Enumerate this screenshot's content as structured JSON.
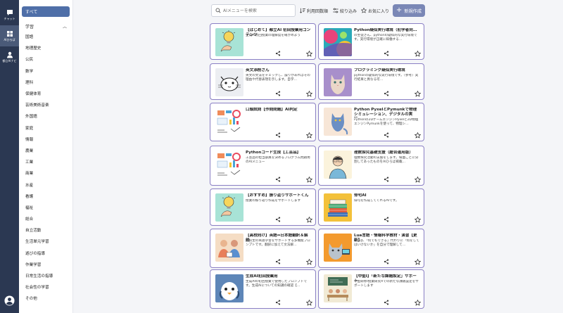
{
  "rail": {
    "items": [
      {
        "label": "チャット",
        "icon": "chat-icon"
      },
      {
        "label": "AIひろば",
        "icon": "grid-icon"
      },
      {
        "label": "都立AIナビ",
        "icon": "person-icon"
      }
    ]
  },
  "sidebar": {
    "all_label": "すべて",
    "section_label": "学習",
    "categories": [
      "国語",
      "地理歴史",
      "公民",
      "数学",
      "理科",
      "保健体育",
      "芸術美術音楽",
      "外国語",
      "家庭",
      "情報",
      "農業",
      "工業",
      "商業",
      "水産",
      "看護",
      "福祉",
      "総合",
      "自立活動",
      "生活単元学習",
      "遊びの指導",
      "作業学習",
      "日常生活の指導",
      "社会性の学習",
      "その他"
    ]
  },
  "toolbar": {
    "search_placeholder": "AIメニューを検索",
    "sort_label": "利用回数順",
    "filter_label": "絞り込み",
    "favorites_label": "お気に入り",
    "new_label": "新規作成"
  },
  "colors": {
    "rail": "#2b3852",
    "accent": "#4f6fa8",
    "card_border": "#8a7fc4",
    "new_button": "#7a87b6"
  },
  "cards": [
    {
      "title": "【はじめて】都立AI 初回授業用コンテンツ",
      "desc": "生成AI初回授業の理解度を確かめよう",
      "thumb": "lightbulb"
    },
    {
      "title": "Python疑似実行環境（初学者向…",
      "desc": "の生徒さん、pythonの疑似的な実行環境です。実行環境が正確に稼働する…",
      "thumb": "abstract"
    },
    {
      "title": "英文添削さん",
      "desc": "英文の文法をチェックし、誤りがあればその理由や代替表現を示します。自学…",
      "thumb": "cat"
    },
    {
      "title": "プログラミング疑似実行環境",
      "desc": "pythonの疑似的な実行環境です。（参考）実行結果と異なる可…",
      "thumb": "purplecat"
    },
    {
      "title": "口頭試問【作問問題】AI判定",
      "desc": "",
      "thumb": "infographic"
    },
    {
      "title": "Python PyxelとPymunkで物理シミュレーション、デジタルの実験…",
      "desc": "Pythonの2DゲームエンジンPyxelと2D物理エンジンPymunkを使って、物理シ…",
      "thumb": "bluecat"
    },
    {
      "title": "Pythonコード生成【工芸品】",
      "desc": "工芸品の担当部員を決めるプログラム問題用のAIメニュー",
      "thumb": "infographic"
    },
    {
      "title": "理数探究基礎支援（総合運用版）",
      "desc": "理数探究活動の支援をします。場面ごとに分割してあったものをAIひろば掲載…",
      "thumb": "student"
    },
    {
      "title": "【おすすめ】振り返りサポートくん",
      "desc": "授業の振り返り作成をサポートします",
      "thumb": "lightbulb"
    },
    {
      "title": "俳句AI",
      "desc": "俳句を作成してくれるAIです。",
      "thumb": "books"
    },
    {
      "title": "【高校向け】英語⇔日本語翻訳＆解説",
      "desc": "高校生の英語学習をサポートする多機能プロンプトです。翻訳に加えて文法解…",
      "thumb": "people"
    },
    {
      "title": "Lua言語・情報科学教材・演習【更新】",
      "desc": "Luaは、「何でもできる」代わりに「何をしてはいけないか」を自分で理解して…",
      "thumb": "cat2"
    },
    {
      "title": "生成AI初回授業用",
      "desc": "生成AIの初回授業で使用したプロンプトです。生成AIについての知識の確認【…",
      "thumb": "penguin"
    },
    {
      "title": "【中堅Ⅰ】「新たな課題設定」サポート",
      "desc": "中堅研修Ⅰ授業研究Aでの新たな課題設定をサポートします",
      "thumb": "classroom"
    }
  ]
}
